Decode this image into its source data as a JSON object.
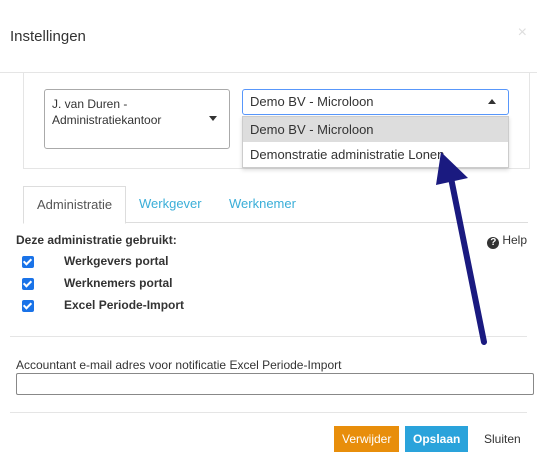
{
  "dialog": {
    "title": "Instellingen",
    "close_label": "×"
  },
  "office_select": {
    "value": "J. van Duren - Administratiekantoor"
  },
  "admin_select": {
    "value": "Demo BV - Microloon",
    "options": [
      "Demo BV - Microloon",
      "Demonstratie administratie Lonen"
    ]
  },
  "tabs": [
    "Administratie",
    "Werkgever",
    "Werknemer"
  ],
  "section": {
    "label": "Deze administratie gebruikt:",
    "help_label": "Help",
    "help_glyph": "?"
  },
  "features": [
    {
      "label": "Werkgevers portal",
      "checked": true
    },
    {
      "label": "Werknemers portal",
      "checked": true
    },
    {
      "label": "Excel Periode-Import",
      "checked": true
    }
  ],
  "email": {
    "label": "Accountant e-mail adres voor notificatie Excel Periode-Import",
    "value": ""
  },
  "footer": {
    "delete_label": "Verwijder",
    "save_label": "Opslaan",
    "close_label": "Sluiten"
  },
  "colors": {
    "accent_blue": "#2aa3db",
    "delete_orange": "#e88e0b",
    "arrow": "#1a1a80"
  }
}
